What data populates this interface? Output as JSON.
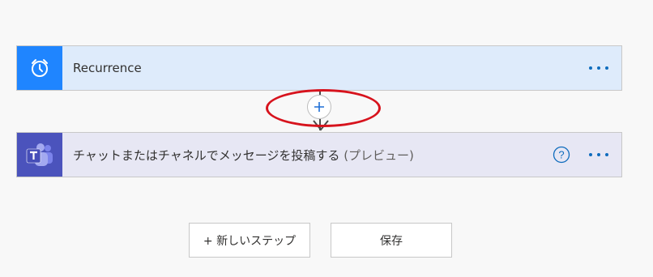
{
  "flow": {
    "steps": [
      {
        "title": "Recurrence",
        "icon": "alarm-clock-icon",
        "icon_bg": "#1f85ff",
        "card_bg": "#deebfb",
        "more_label": "···"
      },
      {
        "title": "チャットまたはチャネルでメッセージを投稿する",
        "suffix": "(プレビュー)",
        "icon": "teams-icon",
        "icon_bg": "#4b53bc",
        "card_bg": "#e7e7f4",
        "help_label": "?",
        "more_label": "···"
      }
    ],
    "insert_step_label": "+",
    "highlight_color": "#d7131d"
  },
  "footer": {
    "new_step_label": "+ 新しいステップ",
    "save_label": "保存"
  },
  "colors": {
    "accent": "#1f85ff",
    "teams": "#4b53bc",
    "background": "#f8f8f8"
  }
}
